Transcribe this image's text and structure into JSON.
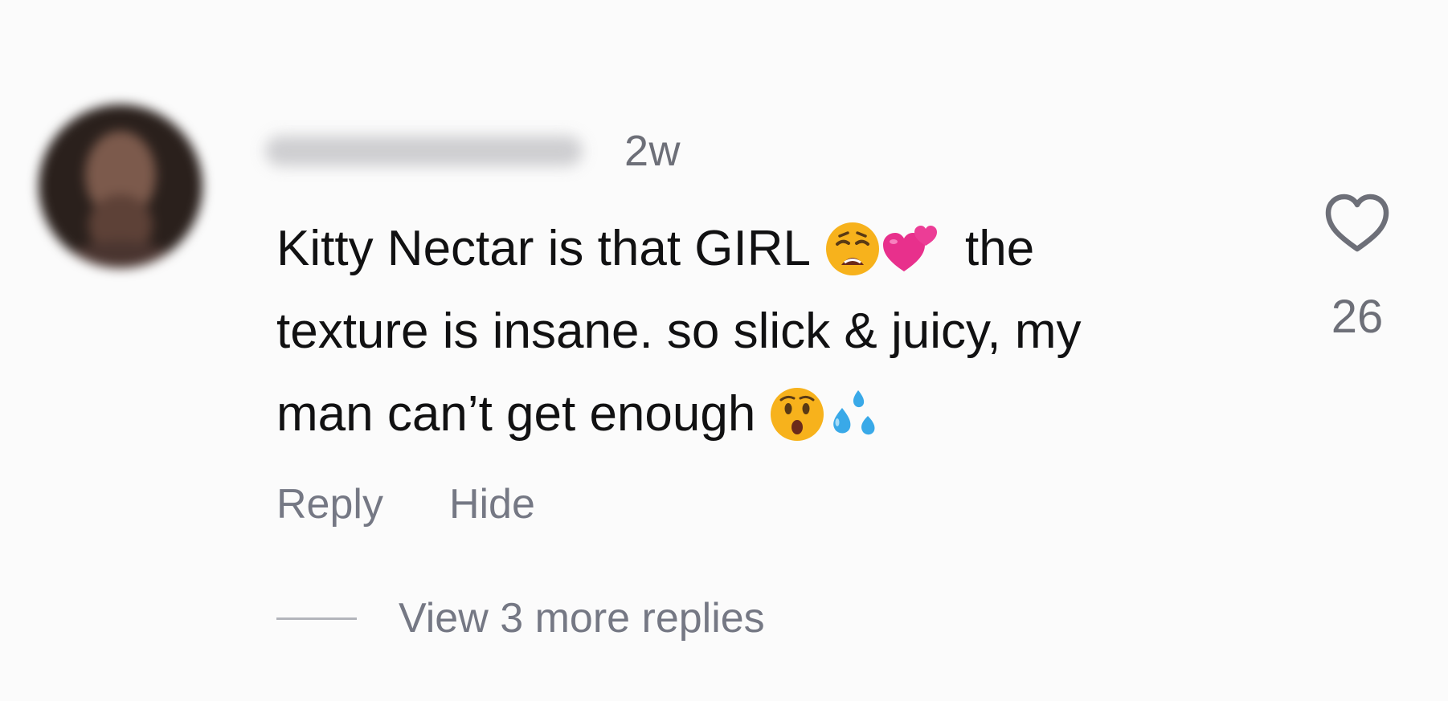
{
  "comment": {
    "timestamp": "2w",
    "text_lines": [
      [
        "Kitty Nectar is that GIRL",
        "the"
      ],
      [
        "texture is insane. so slick & juicy, my"
      ],
      [
        "man can’t get enough"
      ]
    ],
    "emojis": [
      "weary-face-emoji",
      "two-hearts-emoji",
      "hushed-face-emoji",
      "sweat-droplets-emoji"
    ],
    "like_count": "26"
  },
  "actions": {
    "reply_label": "Reply",
    "hide_label": "Hide"
  },
  "replies": {
    "view_more_label": "View 3 more replies"
  },
  "colors": {
    "background": "#fbfbfb",
    "text": "#111112",
    "secondary_text": "#757884",
    "emoji_yellow": "#f7b21c",
    "emoji_pink": "#e8308c",
    "emoji_blue": "#39a9e8"
  }
}
